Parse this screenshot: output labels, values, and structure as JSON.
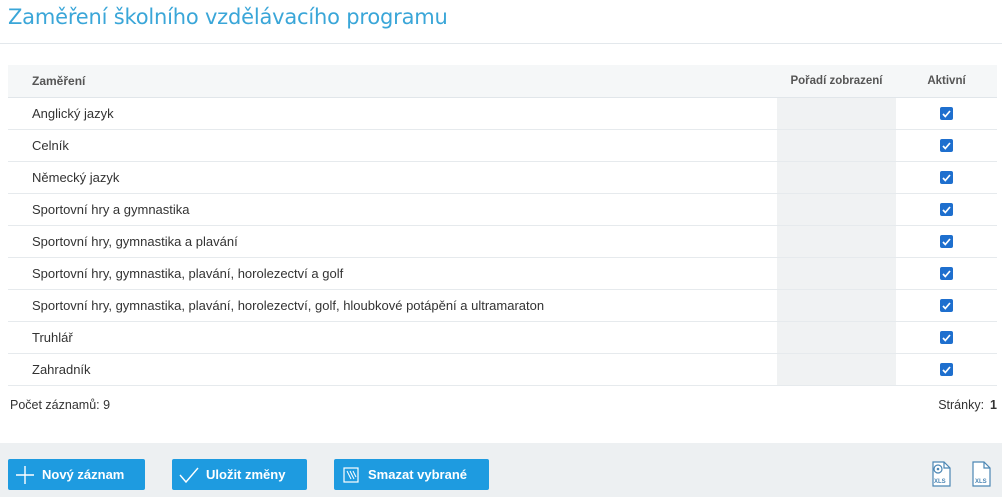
{
  "page": {
    "title": "Zaměření školního vzdělávacího programu"
  },
  "table": {
    "columns": {
      "name": "Zaměření",
      "order": "Pořadí zobrazení",
      "active": "Aktivní"
    },
    "rows": [
      {
        "name": "Anglický jazyk",
        "order": "",
        "active": true
      },
      {
        "name": "Celník",
        "order": "",
        "active": true
      },
      {
        "name": "Německý jazyk",
        "order": "",
        "active": true
      },
      {
        "name": "Sportovní hry a gymnastika",
        "order": "",
        "active": true
      },
      {
        "name": "Sportovní hry, gymnastika a plavání",
        "order": "",
        "active": true
      },
      {
        "name": "Sportovní hry, gymnastika, plavání, horolezectví a golf",
        "order": "",
        "active": true
      },
      {
        "name": "Sportovní hry, gymnastika, plavání, horolezectví, golf, hloubkové potápění a ultramaraton",
        "order": "",
        "active": true
      },
      {
        "name": "Truhlář",
        "order": "",
        "active": true
      },
      {
        "name": "Zahradník",
        "order": "",
        "active": true
      }
    ]
  },
  "footer": {
    "record_count": "Počet záznamů: 9",
    "pages_label": "Stránky:",
    "page_number": "1"
  },
  "actions": {
    "new_label": "Nový záznam",
    "save_label": "Uložit změny",
    "delete_label": "Smazat vybrané"
  },
  "exports": [
    {
      "icon": "xls-settings-export-icon",
      "label": "XLS"
    },
    {
      "icon": "xls-export-icon",
      "label": "XLS"
    }
  ],
  "colors": {
    "accent": "#3aa6d8",
    "button": "#1e9be0",
    "checkbox": "#1e6fce"
  }
}
